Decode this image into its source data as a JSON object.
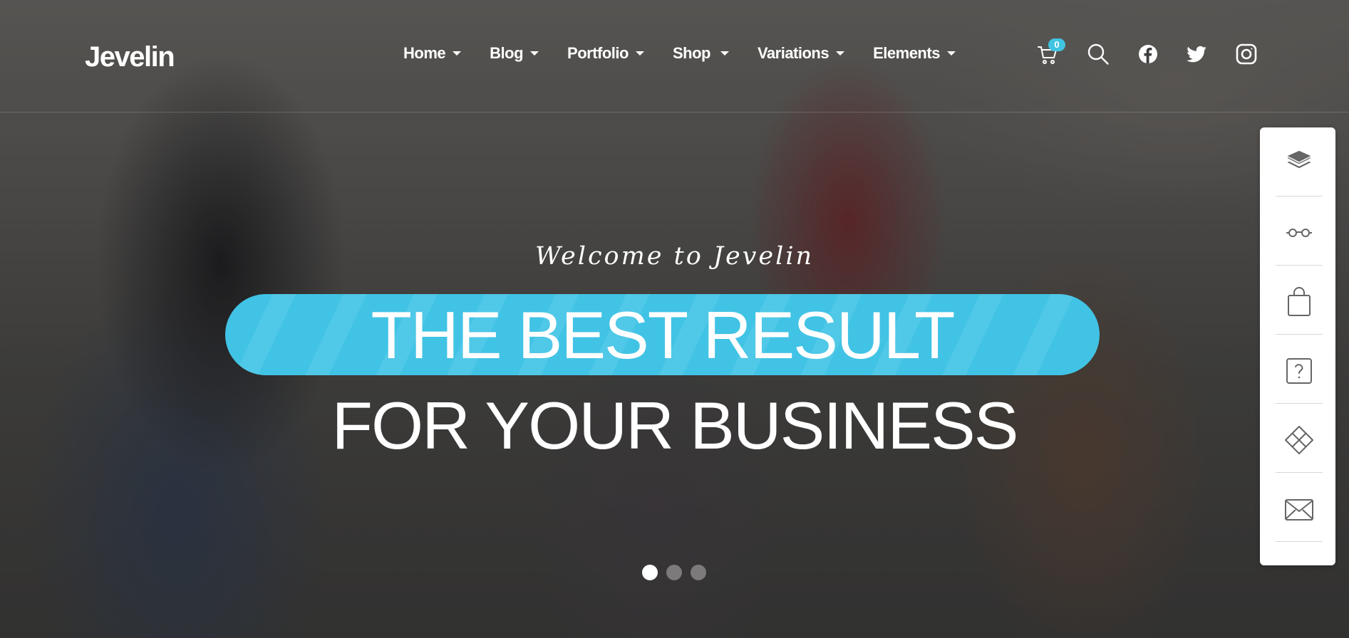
{
  "brand": {
    "logo": "Jevelin",
    "accent": "#41c3e5"
  },
  "nav": {
    "items": [
      {
        "label": "Home"
      },
      {
        "label": "Blog"
      },
      {
        "label": "Portfolio"
      },
      {
        "label": "Shop"
      },
      {
        "label": "Variations"
      },
      {
        "label": "Elements"
      }
    ]
  },
  "header_icons": {
    "cart": {
      "icon": "cart-icon",
      "count": "0"
    },
    "search": {
      "icon": "search-icon"
    },
    "facebook": {
      "icon": "facebook-icon"
    },
    "twitter": {
      "icon": "twitter-icon"
    },
    "instagram": {
      "icon": "instagram-icon"
    }
  },
  "hero": {
    "welcome": "Welcome to Jevelin",
    "headline_line1": "THE BEST RESULT",
    "headline_line2": "FOR YOUR BUSINESS"
  },
  "slider": {
    "slide_count": 3,
    "active_slide": 1
  },
  "side_panel": {
    "items": [
      {
        "icon": "layers-icon"
      },
      {
        "icon": "glasses-icon"
      },
      {
        "icon": "shopping-bag-icon"
      },
      {
        "icon": "help-icon"
      },
      {
        "icon": "diamond-grid-icon"
      },
      {
        "icon": "mail-icon"
      }
    ]
  }
}
